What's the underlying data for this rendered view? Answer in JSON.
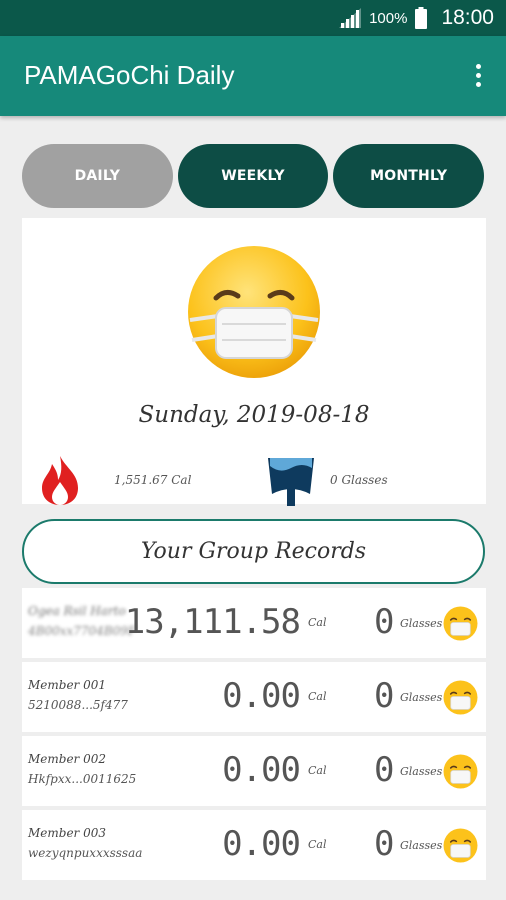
{
  "status_bar": {
    "battery_text": "100%",
    "time": "18:00",
    "icons": [
      "signal-icon",
      "battery-icon"
    ]
  },
  "app_bar": {
    "title": "PAMAGoChi Daily",
    "menu_icon": "overflow-menu-icon"
  },
  "tabs": [
    {
      "label": "DAILY",
      "active": true
    },
    {
      "label": "WEEKLY",
      "active": false
    },
    {
      "label": "MONTHLY",
      "active": false
    }
  ],
  "daily_summary": {
    "mood_icon": "sick-mask-emoji-icon",
    "date": "Sunday, 2019-08-18",
    "calories": "1,551.67 Cal",
    "water": "0 Glasses"
  },
  "group_records": {
    "title": "Your Group Records",
    "records": [
      {
        "name": "Ogea Rsil Harto",
        "id": "4B00xx7704B09F",
        "calories": "13,111.58",
        "cal_unit": "Cal",
        "glasses": "0",
        "glass_unit": "Glasses",
        "name_obscured": true
      },
      {
        "name": "Member 001",
        "id": "5210088...5f477",
        "calories": "0.00",
        "cal_unit": "Cal",
        "glasses": "0",
        "glass_unit": "Glasses",
        "name_obscured": false
      },
      {
        "name": "Member 002",
        "id": "Hkfpxx...0011625",
        "calories": "0.00",
        "cal_unit": "Cal",
        "glasses": "0",
        "glass_unit": "Glasses",
        "name_obscured": false
      },
      {
        "name": "Member 003",
        "id": "wezyqnpuxxxsssaa",
        "calories": "0.00",
        "cal_unit": "Cal",
        "glasses": "0",
        "glass_unit": "Glasses",
        "name_obscured": false
      }
    ]
  },
  "colors": {
    "status_bar": "#0b584a",
    "app_bar": "#16897a",
    "tab_active": "#a1a1a1",
    "tab_inactive": "#0d4d45",
    "accent_border": "#1b7a6b"
  }
}
